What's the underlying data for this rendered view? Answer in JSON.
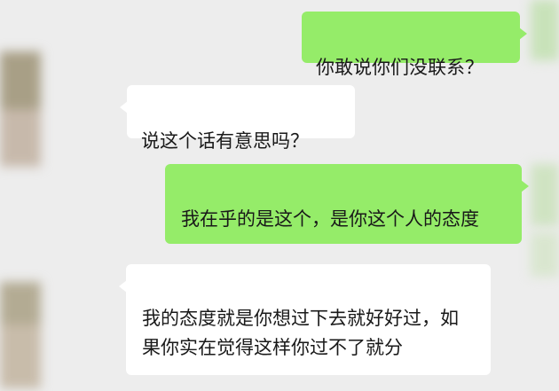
{
  "colors": {
    "background": "#ededed",
    "outgoing_bubble": "#95ec69",
    "incoming_bubble": "#ffffff"
  },
  "messages": [
    {
      "direction": "outgoing",
      "text": "你敢说你们没联系？"
    },
    {
      "direction": "incoming",
      "text": "说这个话有意思吗？"
    },
    {
      "direction": "outgoing",
      "text": "我在乎的是这个，是你这个人的态度"
    },
    {
      "direction": "incoming",
      "text": "我的态度就是你想过下去就好好过，如果你实在觉得这样你过不了就分"
    }
  ]
}
